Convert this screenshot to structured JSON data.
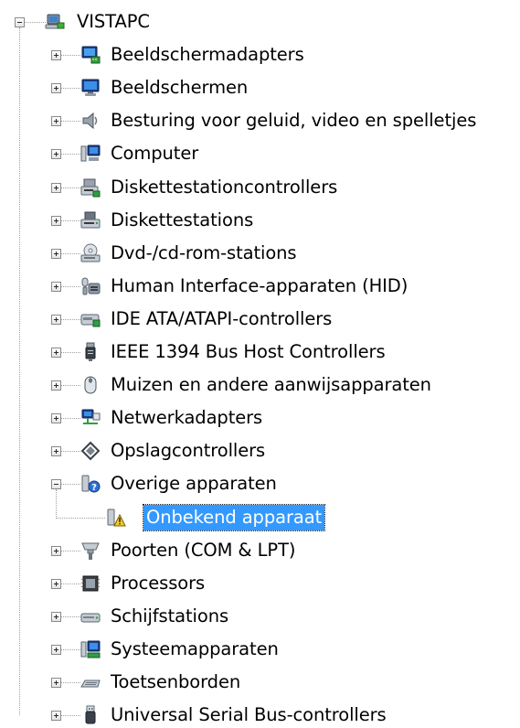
{
  "tree": {
    "root": {
      "label": "VISTAPC",
      "icon": "computer-network-icon",
      "expanded": true
    },
    "items": [
      {
        "label": "Beeldschermadapters",
        "icon": "display-adapter-icon",
        "expanded": false
      },
      {
        "label": "Beeldschermen",
        "icon": "monitor-icon",
        "expanded": false
      },
      {
        "label": "Besturing voor geluid, video en spelletjes",
        "icon": "speaker-icon",
        "expanded": false
      },
      {
        "label": "Computer",
        "icon": "computer-icon",
        "expanded": false
      },
      {
        "label": "Diskettestationcontrollers",
        "icon": "floppy-controller-icon",
        "expanded": false
      },
      {
        "label": "Diskettestations",
        "icon": "floppy-drive-icon",
        "expanded": false
      },
      {
        "label": "Dvd-/cd-rom-stations",
        "icon": "optical-drive-icon",
        "expanded": false
      },
      {
        "label": "Human Interface-apparaten (HID)",
        "icon": "hid-icon",
        "expanded": false
      },
      {
        "label": "IDE ATA/ATAPI-controllers",
        "icon": "ide-controller-icon",
        "expanded": false
      },
      {
        "label": "IEEE 1394 Bus Host Controllers",
        "icon": "firewire-icon",
        "expanded": false
      },
      {
        "label": "Muizen en andere aanwijsapparaten",
        "icon": "mouse-icon",
        "expanded": false
      },
      {
        "label": "Netwerkadapters",
        "icon": "network-adapter-icon",
        "expanded": false
      },
      {
        "label": "Opslagcontrollers",
        "icon": "storage-controller-icon",
        "expanded": false
      },
      {
        "label": "Overige apparaten",
        "icon": "unknown-device-icon",
        "expanded": true,
        "children": [
          {
            "label": "Onbekend apparaat",
            "icon": "unknown-device-warning-icon",
            "selected": true
          }
        ]
      },
      {
        "label": "Poorten (COM & LPT)",
        "icon": "port-icon",
        "expanded": false
      },
      {
        "label": "Processors",
        "icon": "processor-icon",
        "expanded": false
      },
      {
        "label": "Schijfstations",
        "icon": "disk-drive-icon",
        "expanded": false
      },
      {
        "label": "Systeemapparaten",
        "icon": "system-device-icon",
        "expanded": false
      },
      {
        "label": "Toetsenborden",
        "icon": "keyboard-icon",
        "expanded": false
      },
      {
        "label": "Universal Serial Bus-controllers",
        "icon": "usb-icon",
        "expanded": false
      }
    ]
  },
  "colors": {
    "selection": "#3399ff",
    "tree_lines": "#a0a0a0"
  }
}
